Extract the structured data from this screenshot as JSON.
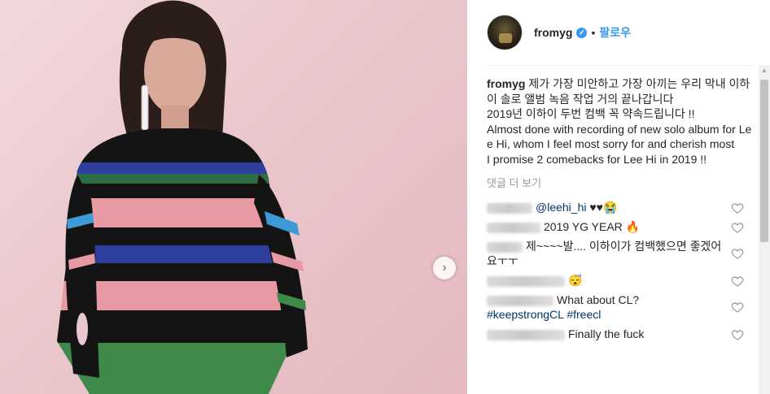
{
  "post": {
    "username": "fromyg",
    "follow_label": "팔로우",
    "dot": "•",
    "caption_text": "제가 가장 미안하고 가장 아끼는 우리 막내 이하이 솔로 앨범 녹음 작업 거의 끝나갑니다\n2019년 이하이 두번 컴백 꼭 약속드립니다 !!\nAlmost done with recording of new solo album for Lee Hi, whom I feel most sorry for and cherish most\nI promise 2 comebacks for Lee Hi in 2019 !!",
    "more_comments": "댓글 더 보기"
  },
  "comments": [
    {
      "mention": "@leehi_hi",
      "text": " ♥♥😭"
    },
    {
      "text": "2019 YG YEAR 🔥"
    },
    {
      "text": "제~~~~발.... 이하이가 컴백했으면 좋겠어요ㅜㅜ"
    },
    {
      "text": "😴"
    },
    {
      "text": "What about CL?",
      "tags": "#keepstrongCL #freecl"
    },
    {
      "text": "Finally the fuck"
    }
  ],
  "colors": {
    "accent": "#3897f0",
    "link": "#003569",
    "muted": "#999999"
  },
  "icons": {
    "next": "chevron-right-icon",
    "verified": "verified-badge-icon",
    "heart": "heart-outline-icon"
  }
}
